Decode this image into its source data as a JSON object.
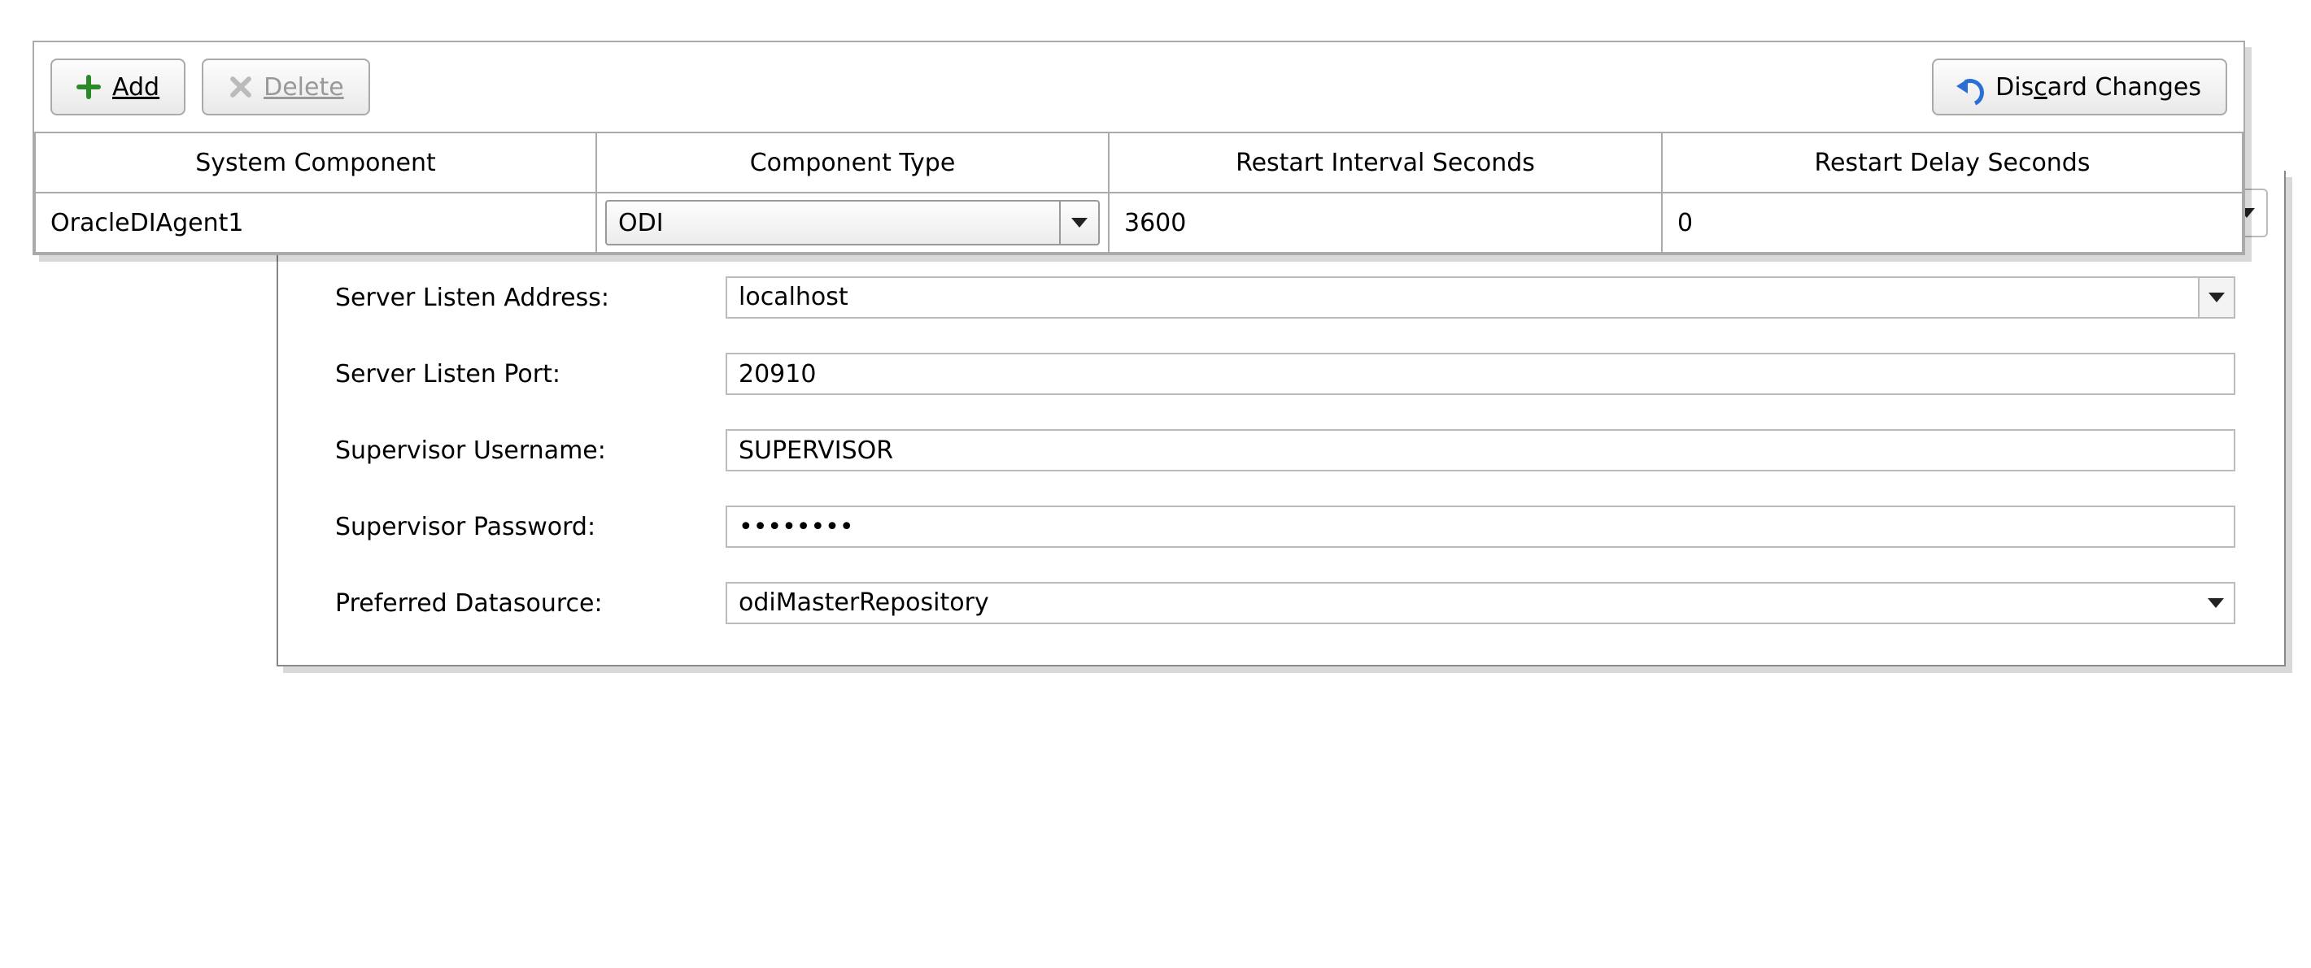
{
  "toolbar": {
    "add_label": "Add",
    "delete_label": "Delete",
    "discard_label": "Discard Changes"
  },
  "grid": {
    "headers": {
      "system_component": "System Component",
      "component_type": "Component Type",
      "restart_interval": "Restart Interval Seconds",
      "restart_delay": "Restart Delay Seconds"
    },
    "row": {
      "system_component": "OracleDIAgent1",
      "component_type": "ODI",
      "restart_interval": "3600",
      "restart_delay": "0"
    }
  },
  "form": {
    "server_listen_address": {
      "label": "Server Listen Address:",
      "value": "localhost"
    },
    "server_listen_port": {
      "label": "Server Listen Port:",
      "value": "20910"
    },
    "supervisor_username": {
      "label": "Supervisor Username:",
      "value": "SUPERVISOR"
    },
    "supervisor_password": {
      "label": "Supervisor Password:",
      "value": "••••••••"
    },
    "preferred_datasource": {
      "label": "Preferred Datasource:",
      "value": "odiMasterRepository"
    }
  }
}
